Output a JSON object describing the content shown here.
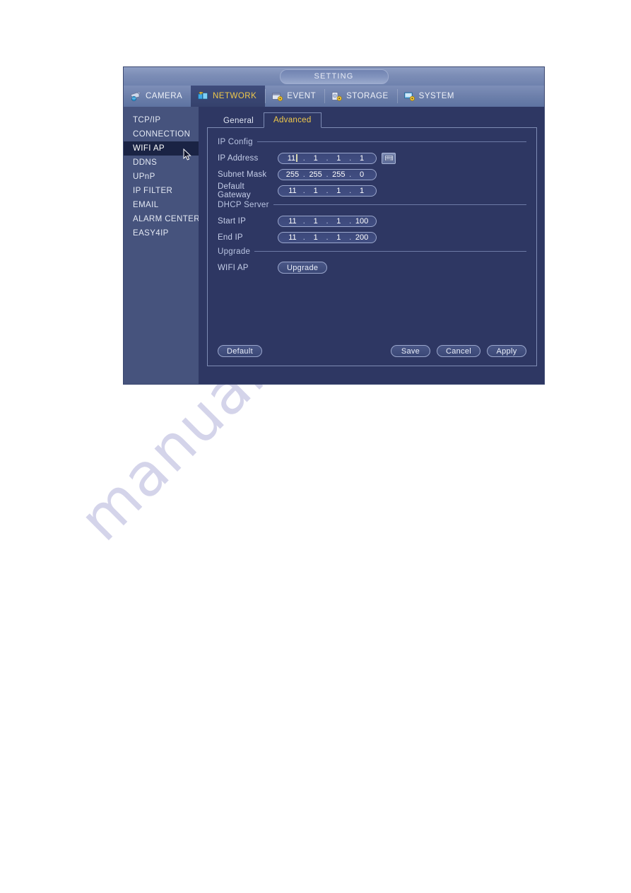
{
  "watermark": {
    "text": "manualshive.com"
  },
  "window": {
    "title": "SETTING"
  },
  "top_tabs": [
    {
      "label": "CAMERA",
      "icon": "camera-icon",
      "active": false
    },
    {
      "label": "NETWORK",
      "icon": "network-icon",
      "active": true
    },
    {
      "label": "EVENT",
      "icon": "event-icon",
      "active": false
    },
    {
      "label": "STORAGE",
      "icon": "storage-icon",
      "active": false
    },
    {
      "label": "SYSTEM",
      "icon": "system-icon",
      "active": false
    }
  ],
  "sidebar": {
    "items": [
      {
        "label": "TCP/IP",
        "selected": false
      },
      {
        "label": "CONNECTION",
        "selected": false
      },
      {
        "label": "WIFI AP",
        "selected": true
      },
      {
        "label": "DDNS",
        "selected": false
      },
      {
        "label": "UPnP",
        "selected": false
      },
      {
        "label": "IP FILTER",
        "selected": false
      },
      {
        "label": "EMAIL",
        "selected": false
      },
      {
        "label": "ALARM CENTER",
        "selected": false
      },
      {
        "label": "EASY4IP",
        "selected": false
      }
    ]
  },
  "sub_tabs": [
    {
      "label": "General",
      "active": false
    },
    {
      "label": "Advanced",
      "active": true
    }
  ],
  "sections": {
    "ip_config": {
      "title": "IP Config",
      "ip_address": {
        "label": "IP Address",
        "octets": [
          "11",
          "1",
          "1",
          "1"
        ],
        "has_caret": true,
        "keyboard_button": "numpad-icon"
      },
      "subnet_mask": {
        "label": "Subnet Mask",
        "octets": [
          "255",
          "255",
          "255",
          "0"
        ]
      },
      "default_gateway": {
        "label": "Default Gateway",
        "octets": [
          "11",
          "1",
          "1",
          "1"
        ]
      }
    },
    "dhcp_server": {
      "title": "DHCP Server",
      "start_ip": {
        "label": "Start IP",
        "octets": [
          "11",
          "1",
          "1",
          "100"
        ]
      },
      "end_ip": {
        "label": "End IP",
        "octets": [
          "11",
          "1",
          "1",
          "200"
        ]
      }
    },
    "upgrade": {
      "title": "Upgrade",
      "wifi_ap": {
        "label": "WIFI AP",
        "button_label": "Upgrade"
      }
    }
  },
  "footer": {
    "default_label": "Default",
    "save_label": "Save",
    "cancel_label": "Cancel",
    "apply_label": "Apply"
  },
  "colors": {
    "accent_gold": "#f0c94a",
    "sidebar_bg": "#46537d",
    "content_bg": "#2e3763",
    "selected_item_bg": "#1a2344",
    "border": "#7e8cb4"
  }
}
